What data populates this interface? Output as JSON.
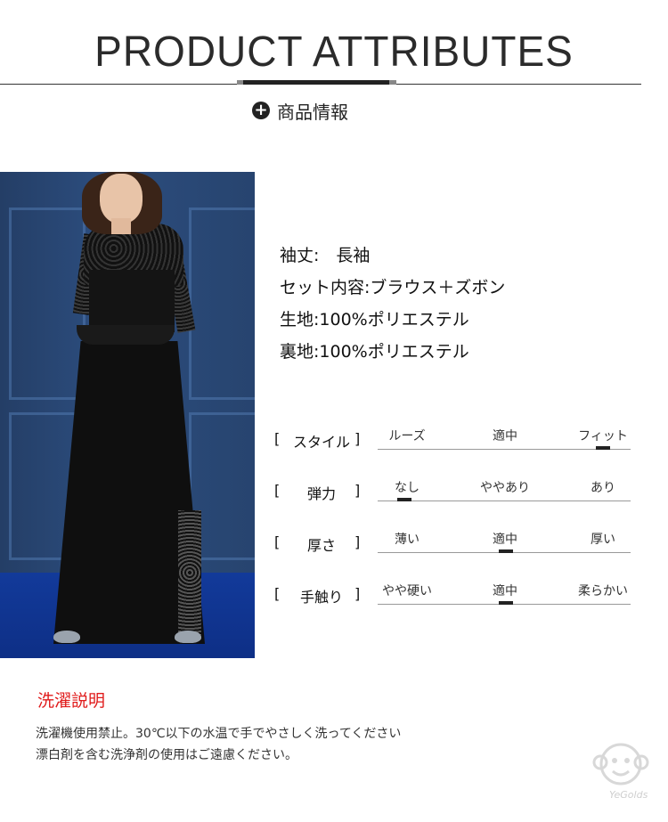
{
  "header": {
    "title": "PRODUCT ATTRIBUTES",
    "subtitle": "商品情報",
    "subtitle_icon": "plus-circle-icon"
  },
  "photo": {
    "description_icon": "model-photo"
  },
  "attributes": [
    {
      "text": "袖丈:　長袖"
    },
    {
      "text": "セット内容:ブラウス＋ズボン"
    },
    {
      "text": "生地:100%ポリエステル"
    },
    {
      "text": "裏地:100%ポリエステル"
    }
  ],
  "scales": [
    {
      "label": "スタイル",
      "options": [
        "ルーズ",
        "適中",
        "フィット"
      ],
      "selected_index": 2
    },
    {
      "label": "弾力",
      "options": [
        "なし",
        "ややあり",
        "あり"
      ],
      "selected_index": 0
    },
    {
      "label": "厚さ",
      "options": [
        "薄い",
        "適中",
        "厚い"
      ],
      "selected_index": 1
    },
    {
      "label": "手触り",
      "options": [
        "やや硬い",
        "適中",
        "柔らかい"
      ],
      "selected_index": 1
    }
  ],
  "washing": {
    "title": "洗濯説明",
    "lines": [
      "洗濯機使用禁止。30℃以下の水温で手でやさしく洗ってください",
      "漂白剤を含む洗浄剤の使用はご遠慮ください。"
    ]
  },
  "watermark": {
    "text": "YeGolds",
    "icon": "monkey-logo-icon"
  },
  "colors": {
    "accent_red": "#e01b1b",
    "text_dark": "#222222"
  }
}
